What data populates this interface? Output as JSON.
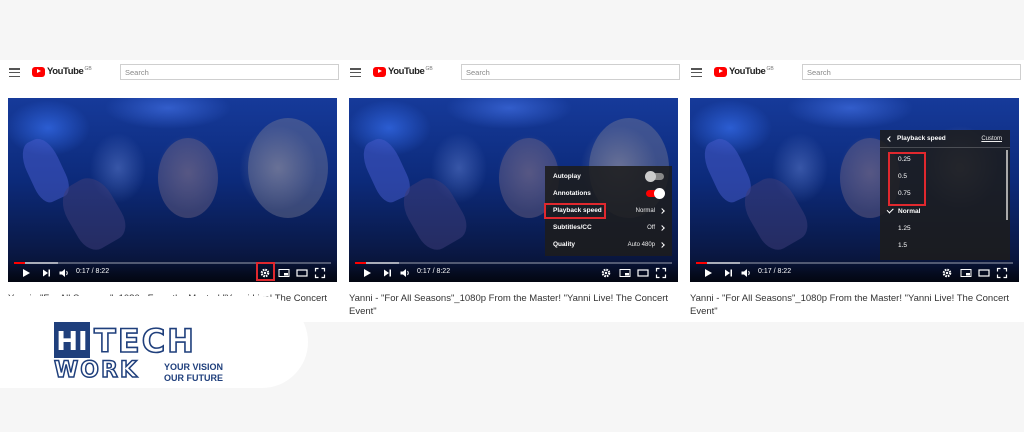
{
  "app": {
    "logo_text": "YouTube",
    "logo_region": "GB",
    "search_placeholder": "Search"
  },
  "video": {
    "time": "0:17 / 8:22",
    "title": "Yanni - \"For All Seasons\"_1080p From the Master! \"Yanni Live! The Concert Event\"",
    "progress_fraction": 0.034
  },
  "settings_menu": {
    "items": [
      {
        "label": "Autoplay",
        "value": "",
        "toggle": "off"
      },
      {
        "label": "Annotations",
        "value": "",
        "toggle": "on"
      },
      {
        "label": "Playback speed",
        "value": "Normal"
      },
      {
        "label": "Subtitles/CC",
        "value": "Off"
      },
      {
        "label": "Quality",
        "value": "Auto 480p"
      }
    ]
  },
  "speed_menu": {
    "title": "Playback speed",
    "custom_label": "Custom",
    "options": [
      "0.25",
      "0.5",
      "0.75",
      "Normal",
      "1.25",
      "1.5"
    ],
    "selected": "Normal"
  },
  "brand": {
    "hi": "HI",
    "tech": "TECH",
    "work": "WORK",
    "tagline_1": "YOUR VISION",
    "tagline_2": "OUR FUTURE"
  },
  "colors": {
    "accent": "#ff0000",
    "highlight": "#e0282e",
    "brand_blue": "#1f3f7c"
  },
  "icons": [
    "hamburger-icon",
    "play-icon",
    "next-icon",
    "volume-icon",
    "gear-icon",
    "miniplayer-icon",
    "theater-icon",
    "fullscreen-icon",
    "chevron-right-icon",
    "back-chevron-icon",
    "check-icon"
  ]
}
